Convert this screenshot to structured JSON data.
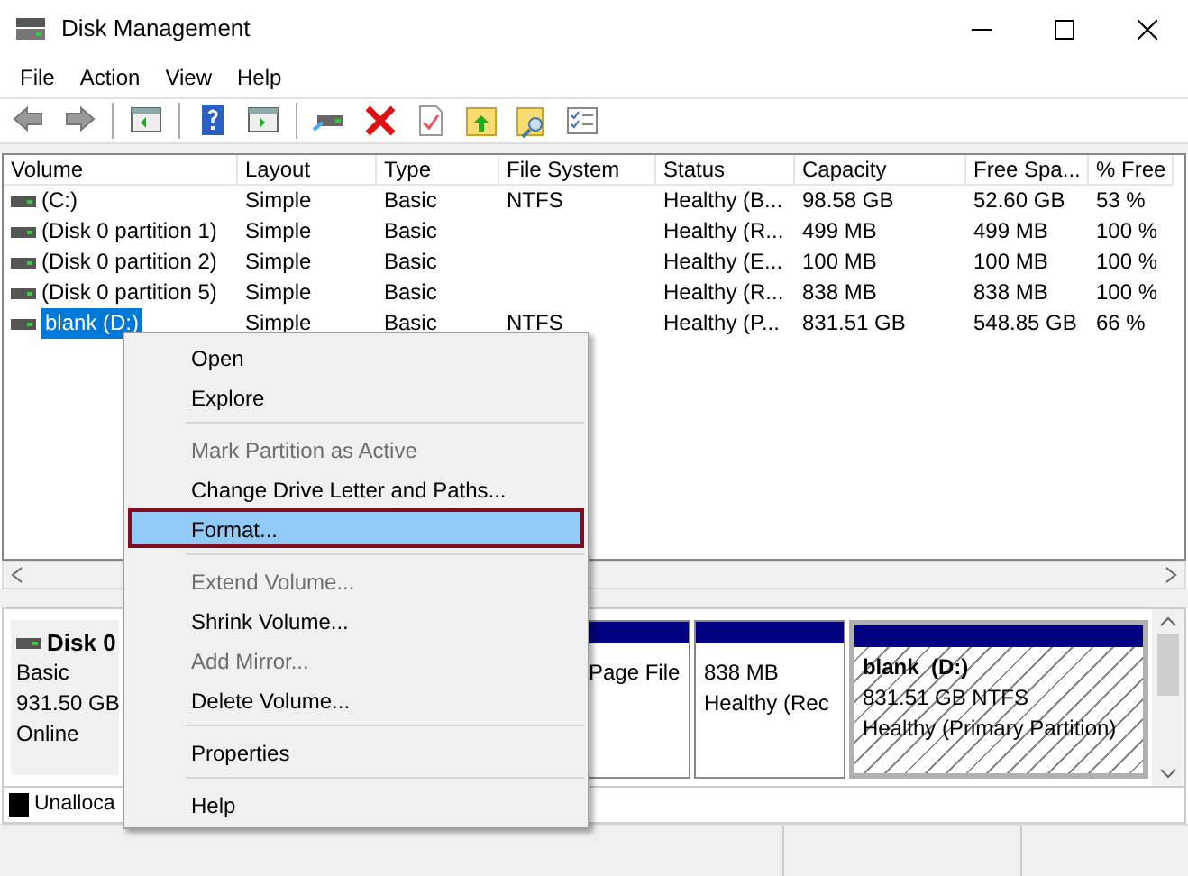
{
  "window": {
    "title": "Disk Management"
  },
  "menu": [
    "File",
    "Action",
    "View",
    "Help"
  ],
  "table": {
    "columns": [
      "Volume",
      "Layout",
      "Type",
      "File System",
      "Status",
      "Capacity",
      "Free Spa...",
      "% Free"
    ],
    "rows": [
      {
        "cells": [
          "(C:)",
          "Simple",
          "Basic",
          "NTFS",
          "Healthy (B...",
          "98.58 GB",
          "52.60 GB",
          "53 %"
        ],
        "selected": false
      },
      {
        "cells": [
          "(Disk 0 partition 1)",
          "Simple",
          "Basic",
          "",
          "Healthy (R...",
          "499 MB",
          "499 MB",
          "100 %"
        ],
        "selected": false
      },
      {
        "cells": [
          "(Disk 0 partition 2)",
          "Simple",
          "Basic",
          "",
          "Healthy (E...",
          "100 MB",
          "100 MB",
          "100 %"
        ],
        "selected": false
      },
      {
        "cells": [
          "(Disk 0 partition 5)",
          "Simple",
          "Basic",
          "",
          "Healthy (R...",
          "838 MB",
          "838 MB",
          "100 %"
        ],
        "selected": false
      },
      {
        "cells": [
          "blank (D:)",
          "Simple",
          "Basic",
          "NTFS",
          "Healthy (P...",
          "831.51 GB",
          "548.85 GB",
          "66 %"
        ],
        "selected": true
      }
    ]
  },
  "disks": [
    {
      "name": "Disk 0",
      "type": "Basic",
      "size": "931.50 GB",
      "status": "Online",
      "partitions": [
        {
          "lines": [
            "Page File"
          ],
          "selected": false
        },
        {
          "lines": [
            "838 MB",
            "Healthy (Rec"
          ],
          "selected": false
        },
        {
          "title": "blank  (D:)",
          "lines": [
            "831.51 GB NTFS",
            "Healthy (Primary Partition)"
          ],
          "selected": true
        }
      ]
    }
  ],
  "legend": [
    {
      "label": "Unalloca",
      "color": "#000000"
    }
  ],
  "context_menu": {
    "items": [
      {
        "kind": "item",
        "label": "Open",
        "disabled": false,
        "selected": false
      },
      {
        "kind": "item",
        "label": "Explore",
        "disabled": false,
        "selected": false
      },
      {
        "kind": "separator"
      },
      {
        "kind": "item",
        "label": "Mark Partition as Active",
        "disabled": true,
        "selected": false
      },
      {
        "kind": "item",
        "label": "Change Drive Letter and Paths...",
        "disabled": false,
        "selected": false
      },
      {
        "kind": "item",
        "label": "Format...",
        "disabled": false,
        "selected": true
      },
      {
        "kind": "separator"
      },
      {
        "kind": "item",
        "label": "Extend Volume...",
        "disabled": true,
        "selected": false
      },
      {
        "kind": "item",
        "label": "Shrink Volume...",
        "disabled": false,
        "selected": false
      },
      {
        "kind": "item",
        "label": "Add Mirror...",
        "disabled": true,
        "selected": false
      },
      {
        "kind": "item",
        "label": "Delete Volume...",
        "disabled": false,
        "selected": false
      },
      {
        "kind": "separator"
      },
      {
        "kind": "item",
        "label": "Properties",
        "disabled": false,
        "selected": false
      },
      {
        "kind": "separator"
      },
      {
        "kind": "item",
        "label": "Help",
        "disabled": false,
        "selected": false
      }
    ]
  }
}
